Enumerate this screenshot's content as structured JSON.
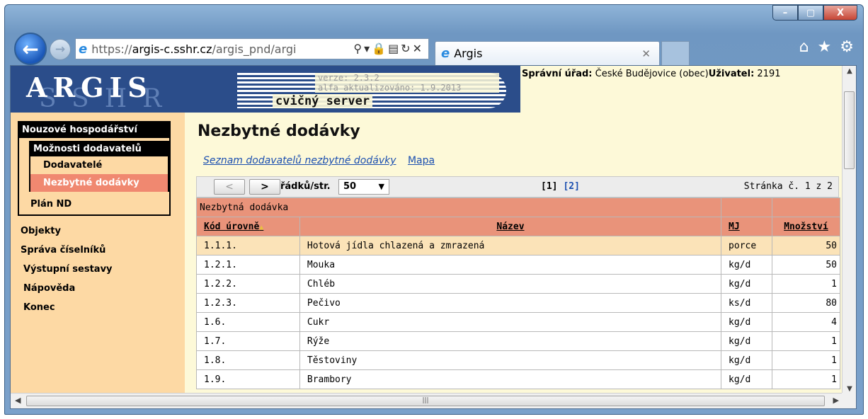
{
  "browser": {
    "url_prefix": "https://",
    "url_host": "argis-c.sshr.cz",
    "url_path": "/argis_pnd/argi",
    "tab_title": "Argis",
    "window_controls": [
      "–",
      "▢",
      "X"
    ]
  },
  "header": {
    "logo": "ARGIS",
    "logo_watermark": "SSHR",
    "version": "verze: 2.3.2",
    "updated": "alfa aktualizováno: 1.9.2013",
    "server_label": "cvičný server",
    "office_label": "Správní úřad:",
    "office_value": "České Budějovice (obec)",
    "user_label": "Uživatel:",
    "user_value": "2191"
  },
  "menu": {
    "section_title": "Nouzové hospodářství",
    "submenu_title": "Možnosti dodavatelů",
    "submenu_items": [
      "Dodavatelé",
      "Nezbytné dodávky"
    ],
    "plan_item": "Plán ND",
    "items": [
      "Objekty",
      "Správa číselníků",
      "Výstupní sestavy",
      "Nápověda",
      "Konec"
    ]
  },
  "page": {
    "title": "Nezbytné dodávky",
    "links": [
      "Seznam dodavatelů nezbytné dodávky",
      "Mapa"
    ]
  },
  "pager": {
    "prev_label": "<",
    "next_label": ">",
    "rows_label": "řádků/str.",
    "rows_value": "50",
    "current_page": "[1]",
    "other_page": "[2]",
    "page_info": "Stránka č. 1 z 2"
  },
  "table": {
    "group_header": "Nezbytná dodávka",
    "columns": [
      "Kód úrovně",
      "Název",
      "MJ",
      "Množství"
    ],
    "rows": [
      [
        "1.1.1.",
        "Hotová jídla chlazená a zmrazená",
        "porce",
        "50"
      ],
      [
        "1.2.1.",
        "Mouka",
        "kg/d",
        "50"
      ],
      [
        "1.2.2.",
        "Chléb",
        "kg/d",
        "1"
      ],
      [
        "1.2.3.",
        "Pečivo",
        "ks/d",
        "80"
      ],
      [
        "1.6.",
        "Cukr",
        "kg/d",
        "4"
      ],
      [
        "1.7.",
        "Rýže",
        "kg/d",
        "1"
      ],
      [
        "1.8.",
        "Těstoviny",
        "kg/d",
        "1"
      ],
      [
        "1.9.",
        "Brambory",
        "kg/d",
        "1"
      ]
    ]
  },
  "colors": {
    "header_blue": "#2b4d8a",
    "menu_bg": "#fdd9a4",
    "active_item": "#f08870",
    "table_header": "#e9937a",
    "highlight_row": "#fbe3b8",
    "link": "#1b4fb0"
  }
}
